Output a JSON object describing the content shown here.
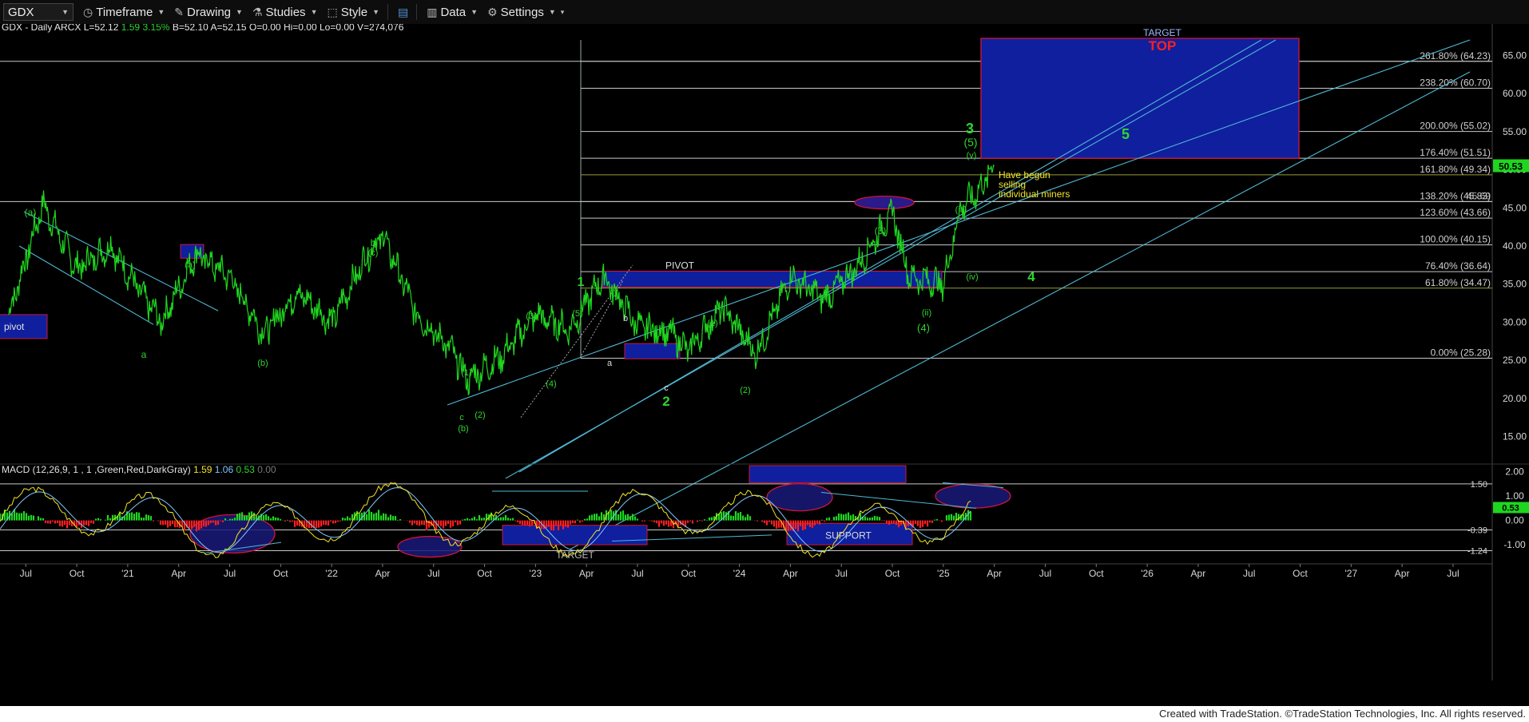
{
  "toolbar": {
    "symbol": "GDX",
    "timeframe": "Timeframe",
    "drawing": "Drawing",
    "studies": "Studies",
    "style": "Style",
    "data": "Data",
    "settings": "Settings"
  },
  "footer": "Created with TradeStation. ©TradeStation Technologies, Inc. All rights reserved.",
  "colors": {
    "price": "#1fd61f",
    "grid": "#c8c8c8",
    "channel": "#4fb8d4",
    "box_fill": "#0f1f9e",
    "box_border": "#d0143c",
    "wave_label": "#2ed62e",
    "note": "#f2e42a",
    "red": "#ff2020"
  },
  "chart_data": [
    {
      "type": "line",
      "title": "GDX - Daily  ARCX",
      "header": {
        "name": "GDX - Daily  ARCX",
        "L": "L=52.12",
        "chg": "1.59",
        "pct": "3.15%",
        "B": "B=52.10",
        "A": "A=52.15",
        "O": "O=0.00",
        "Hi": "Hi=0.00",
        "Lo": "Lo=0.00",
        "V": "V=274,076"
      },
      "x_ticks": [
        "Jul",
        "Oct",
        "'21",
        "Apr",
        "Jul",
        "Oct",
        "'22",
        "Apr",
        "Jul",
        "Oct",
        "'23",
        "Apr",
        "Jul",
        "Oct",
        "'24",
        "Apr",
        "Jul",
        "Oct",
        "'25",
        "Apr",
        "Jul",
        "Oct",
        "'26",
        "Apr",
        "Jul",
        "Oct",
        "'27",
        "Apr",
        "Jul"
      ],
      "y_ticks": [
        "65.00",
        "60.00",
        "55.00",
        "50.00",
        "45.00",
        "40.00",
        "35.00",
        "30.00",
        "25.00",
        "20.00",
        "15.00"
      ],
      "ylim": [
        11.5,
        68.5
      ],
      "last_price_tag": "50.53",
      "series": [
        {
          "x": [
            "2020-06",
            "2020-08",
            "2020-10",
            "2020-12",
            "2021-02",
            "2021-03",
            "2021-05",
            "2021-07",
            "2021-09",
            "2021-11",
            "2022-01",
            "2022-03",
            "2022-04",
            "2022-06",
            "2022-08",
            "2022-09",
            "2022-11",
            "2023-01",
            "2023-03",
            "2023-05",
            "2023-07",
            "2023-09",
            "2023-10",
            "2023-12",
            "2024-02",
            "2024-04",
            "2024-06",
            "2024-08",
            "2024-10",
            "2024-11",
            "2025-01",
            "2025-02",
            "2025-03",
            "2025-04"
          ],
          "values": [
            31,
            45.5,
            37,
            40,
            33,
            30,
            39,
            36,
            28.5,
            34,
            30,
            38.5,
            41.5,
            31,
            26.5,
            22.5,
            25.5,
            31,
            29,
            36,
            29.5,
            28.5,
            26.3,
            32,
            25.8,
            36,
            33,
            37.5,
            44.5,
            36,
            35,
            45,
            47,
            50.5
          ]
        }
      ],
      "fib_levels": [
        {
          "label": "261.80% (64.23)",
          "value": 64.23
        },
        {
          "label": "238.20% (60.70)",
          "value": 60.7
        },
        {
          "label": "200.00% (55.02)",
          "value": 55.02
        },
        {
          "label": "176.40% (51.51)",
          "value": 51.51
        },
        {
          "label": "161.80% (49.34)",
          "value": 49.34
        },
        {
          "label": "138.20% (45.83)",
          "value": 45.83
        },
        {
          "label": "123.60% (43.66)",
          "value": 43.66
        },
        {
          "label": "100.00% (40.15)",
          "value": 40.15
        },
        {
          "label": "76.40% (36.64)",
          "value": 36.64
        },
        {
          "label": "61.80% (34.47)",
          "value": 34.47
        },
        {
          "label": "0.00% (25.28)",
          "value": 25.28
        }
      ],
      "fib_extra_label": "45.69",
      "annotations": {
        "pivot": "pivot",
        "pivot_caps": "PIVOT",
        "target": "TARGET",
        "top": "TOP",
        "support": "SUPPORT",
        "target_macd": "TARGET",
        "note_lines": [
          "Have begun",
          "selling",
          "individual miners"
        ],
        "waves": {
          "a_paren_1": "(a)",
          "a_paren_2": "(a)",
          "b_paren_1": "(b)",
          "b_paren_2": "(b)",
          "c_paren": "(c)",
          "small_a": "a",
          "small_b": "b",
          "small_c": "c",
          "small_a2": "a",
          "small_b2": "b",
          "small_c2": "c",
          "w1": "(1)",
          "w2": "(2)",
          "w3": "(3)",
          "w4": "(4)",
          "w5": "(5)",
          "w1b": "(1)",
          "w2b": "(2)",
          "w3b": "(3)",
          "w4b": "(4)",
          "w5b": "(5)",
          "big1": "1",
          "big2": "2",
          "big3": "3",
          "big4": "4",
          "big5": "5",
          "iii": "(iii)",
          "iv": "(iv)",
          "ii": "(ii)",
          "v": "(v)"
        }
      }
    },
    {
      "type": "line",
      "title": "MACD (12,26,9, 1 , 1 ,Green,Red,DarkGray)",
      "values_text": [
        "1.59",
        "1.06",
        "0.53",
        "0.00"
      ],
      "y_ticks": [
        "2.00",
        "1.00",
        "0.00",
        "-1.00"
      ],
      "ylim": [
        -1.75,
        2.25
      ],
      "ref_levels": [
        {
          "label": "1.50",
          "value": 1.5
        },
        {
          "label": "-0.39",
          "value": -0.39
        },
        {
          "label": "-1.24",
          "value": -1.24
        }
      ],
      "last_tag": "0.53"
    }
  ]
}
